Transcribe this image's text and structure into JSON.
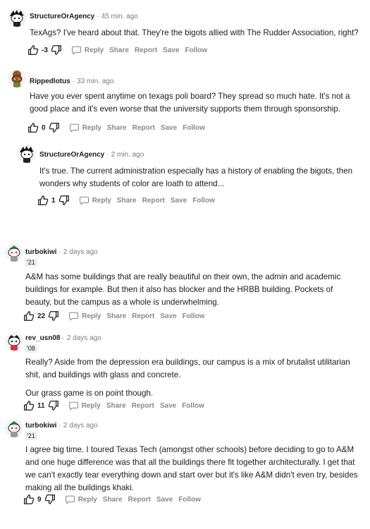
{
  "actions": {
    "reply": "Reply",
    "share": "Share",
    "report": "Report",
    "save": "Save",
    "follow": "Follow"
  },
  "thread1": {
    "c1": {
      "author": "StructureOrAgency",
      "time": "45 min. ago",
      "body": [
        "TexAgs? I've heard about that. They're the bigots allied with The Rudder Association, right?"
      ],
      "score": "-3"
    },
    "c2": {
      "author": "Rippedlotus",
      "time": "33 min. ago",
      "body": [
        "Have you ever spent anytime on texags poli board? They spread so much hate. It's not a good place and it's even worse that the university supports them through sponsorship."
      ],
      "score": "0"
    },
    "c3": {
      "author": "StructureOrAgency",
      "time": "2 min. ago",
      "body": [
        "It's true. The current administration especially has a history of enabling the bigots, then wonders why students of color are loath to attend..."
      ],
      "score": "1"
    }
  },
  "thread2": {
    "c1": {
      "author": "turbokiwi",
      "time": "2 days ago",
      "flair": "'21",
      "body": [
        "A&M has some buildings that are really beautiful on their own, the admin and academic buildings for example. But then it also has blocker and the HRBB building. Pockets of beauty, but the campus as a whole is underwhelming."
      ],
      "score": "22"
    },
    "c2": {
      "author": "rev_usn08",
      "time": "2 days ago",
      "flair": "'08",
      "body": [
        "Really? Aside from the depression era buildings, our campus is a mix of brutalist utilitarian shit, and buildings with glass and concrete.",
        "Our grass game is on point though."
      ],
      "score": "11"
    },
    "c3": {
      "author": "turbokiwi",
      "time": "2 days ago",
      "flair": "'21",
      "body": [
        "I agree big time. I toured Texas Tech (amongst other schools) before deciding to go to A&M and one huge difference was that all the buildings there fit together architecturally. I get that we can't exactly tear everything down and start over but it's like A&M didn't even try, besides making all the buildings khaki."
      ],
      "score": "9"
    }
  },
  "icons": {
    "upvote": "thumb-up-outline",
    "downvote": "thumb-down-outline",
    "reply": "speech-bubble-outline"
  },
  "colors": {
    "meta_gray": "#878a8c",
    "text": "#1c1c1c",
    "flair_bg": "#edeff1"
  }
}
